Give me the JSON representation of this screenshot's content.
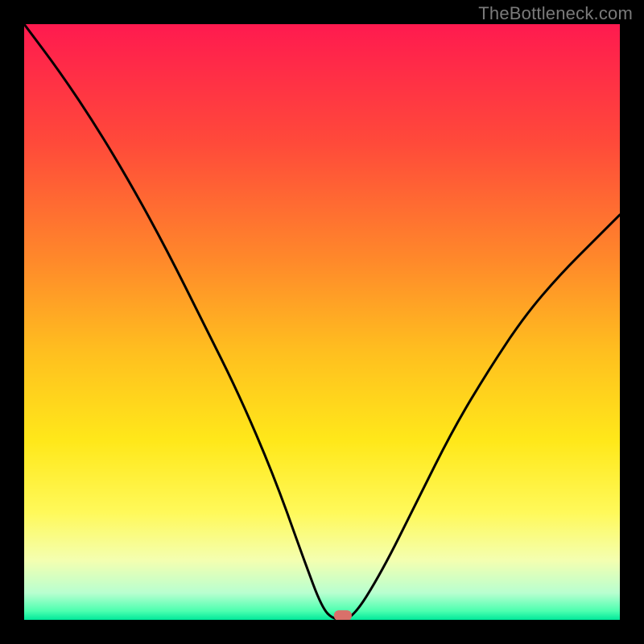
{
  "watermark": "TheBottleneck.com",
  "chart_data": {
    "type": "line",
    "title": "",
    "xlabel": "",
    "ylabel": "",
    "xlim": [
      0,
      100
    ],
    "ylim": [
      0,
      100
    ],
    "grid": false,
    "legend": false,
    "series": [
      {
        "name": "bottleneck-curve",
        "x": [
          0,
          6,
          12,
          18,
          24,
          30,
          36,
          42,
          47,
          50,
          52,
          55,
          60,
          66,
          72,
          78,
          84,
          90,
          96,
          100
        ],
        "y": [
          100,
          92,
          83,
          73,
          62,
          50,
          38,
          24,
          10,
          2,
          0,
          0,
          8,
          20,
          32,
          42,
          51,
          58,
          64,
          68
        ]
      }
    ],
    "marker": {
      "x": 53.5,
      "y": 0.8,
      "color": "#d9706a"
    },
    "gradient_stops": [
      {
        "offset": 0.0,
        "color": "#ff1a4f"
      },
      {
        "offset": 0.2,
        "color": "#ff4a3a"
      },
      {
        "offset": 0.4,
        "color": "#ff8a2a"
      },
      {
        "offset": 0.55,
        "color": "#ffbf1f"
      },
      {
        "offset": 0.7,
        "color": "#ffe81a"
      },
      {
        "offset": 0.82,
        "color": "#fff95a"
      },
      {
        "offset": 0.9,
        "color": "#f4ffb0"
      },
      {
        "offset": 0.955,
        "color": "#b8ffd0"
      },
      {
        "offset": 0.985,
        "color": "#4dffb0"
      },
      {
        "offset": 1.0,
        "color": "#00e89a"
      }
    ]
  }
}
